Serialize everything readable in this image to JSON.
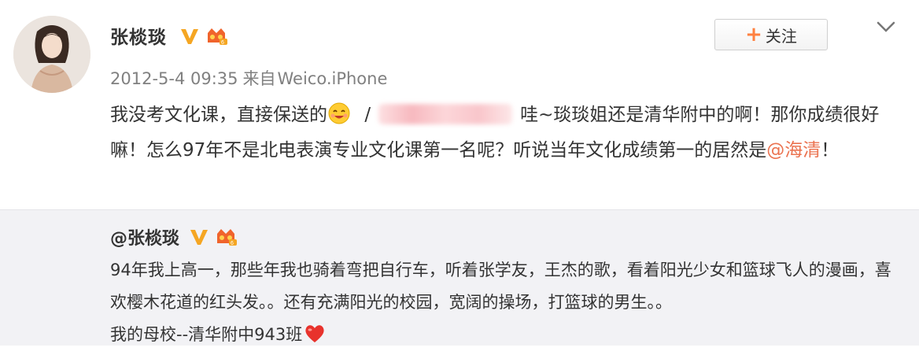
{
  "post": {
    "author": "张棪琰",
    "date": "2012-5-4 09:35",
    "source_prefix": "来自",
    "source": "Weico.iPhone",
    "follow_label": "关注",
    "text_part1": "我没考文化课，直接保送的",
    "text_part2": "/",
    "text_part3": "哇~琰琰姐还是清华附中的啊！那你成绩很好嘛！怎么97年不是北电表演专业文化课第一名呢？听说当年文化成绩第一的居然是",
    "mention": "@海清",
    "text_end": "！"
  },
  "repost": {
    "author": "@张棪琰",
    "text_line1": "94年我上高一，那些年我也骑着弯把自行车，听着张学友，王杰的歌，看着阳光少女和篮球飞人的漫画，喜欢樱木花道的红头发。。还有充满阳光的校园，宽阔的操场，打篮球的男生。。",
    "text_line2": "我的母校--清华附中943班"
  },
  "icons": {
    "verified": "verified-v-icon",
    "vip": "vip-level-icon",
    "emoji": "smiling-emoji-icon",
    "heart": "heart-icon",
    "chevron": "chevron-down-icon"
  },
  "colors": {
    "accent": "#ff8140",
    "mention": "#eb7350",
    "verified": "#f5a623"
  }
}
